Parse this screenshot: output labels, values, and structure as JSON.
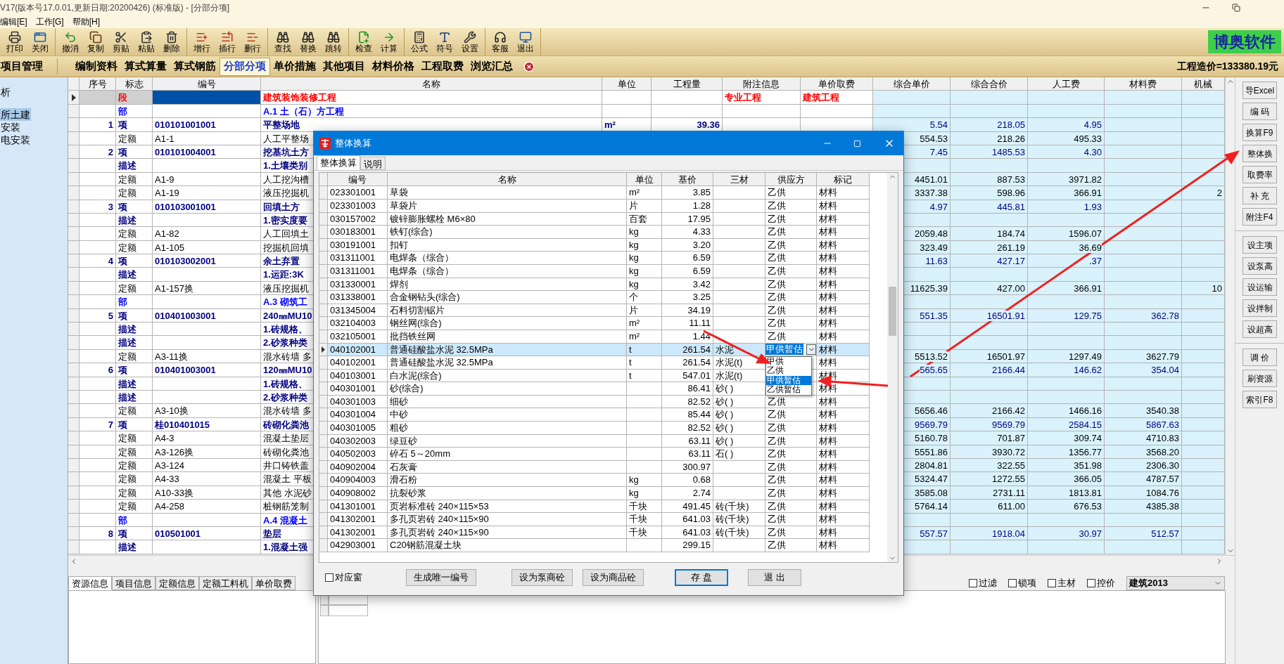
{
  "window": {
    "title": "V17(版本号17.0.01,更新日期:20200426) (标准版) - [分部分项]"
  },
  "menu": [
    "编辑[E]",
    "工作[G]",
    "帮助[H]"
  ],
  "toolbar": [
    [
      "打印",
      "关闭"
    ],
    [
      "撤消",
      "复制",
      "剪贴",
      "粘贴",
      "删除"
    ],
    [
      "增行",
      "插行",
      "删行"
    ],
    [
      "查找",
      "替换",
      "跳转"
    ],
    [
      "检查",
      "计算"
    ],
    [
      "公式",
      "符号",
      "设置"
    ],
    [
      "客服",
      "退出"
    ]
  ],
  "logo": "博奥软件",
  "project_tab": "项目管理",
  "tabs": [
    {
      "label": "编制资料",
      "selected": false
    },
    {
      "label": "算式算量",
      "selected": false
    },
    {
      "label": "算式钢筋",
      "selected": false
    },
    {
      "label": "分部分项",
      "selected": true
    },
    {
      "label": "单价措施",
      "selected": false
    },
    {
      "label": "其他项目",
      "selected": false
    },
    {
      "label": "材料价格",
      "selected": false
    },
    {
      "label": "工程取费",
      "selected": false
    },
    {
      "label": "浏览汇总",
      "selected": false
    }
  ],
  "total": "工程造价=133380.19元",
  "tree": [
    {
      "label": "析",
      "selected": false
    },
    {
      "label": "所土建",
      "selected": true
    },
    {
      "label": "安装",
      "selected": false
    },
    {
      "label": "电安装",
      "selected": false
    }
  ],
  "table": {
    "columns": [
      "序号",
      "标志",
      "编号",
      "名称",
      "单位",
      "工程量",
      "附注信息",
      "单价取费",
      "综合单价",
      "综合合价",
      "人工费",
      "材料费",
      "机械"
    ],
    "rows": [
      {
        "kind": "section",
        "flag": "段",
        "name": "建筑装饰装修工程",
        "note": "专业工程",
        "fee": "建筑工程",
        "selected": true
      },
      {
        "kind": "part",
        "flag": "部",
        "name": "A.1 土（石）方工程",
        "selected": false
      },
      {
        "kind": "item",
        "seq": "1",
        "flag": "项",
        "code": "010101001001",
        "name": "平整场地",
        "unit": "m²",
        "quantity": "39.36",
        "unit_price": "5.54",
        "total": "218.05",
        "labor": "4.95",
        "selected": false
      },
      {
        "kind": "quota",
        "flag": "定额",
        "code": "A1-1",
        "name": "人工平整场",
        "unit_price": "554.53",
        "total": "218.26",
        "labor": "495.33",
        "selected": false
      },
      {
        "kind": "item",
        "seq": "2",
        "flag": "项",
        "code": "010101004001",
        "name": "挖基坑土方",
        "unit_price": "7.45",
        "total": "1485.53",
        "labor": "4.30",
        "selected": false
      },
      {
        "kind": "desc",
        "flag": "描述",
        "name": "1.土壤类别",
        "selected": false
      },
      {
        "kind": "quota",
        "flag": "定额",
        "code": "A1-9",
        "name": "人工挖沟槽",
        "unit_price": "4451.01",
        "total": "887.53",
        "labor": "3971.82",
        "selected": false
      },
      {
        "kind": "quota",
        "flag": "定额",
        "code": "A1-19",
        "name": "液压挖掘机",
        "unit_price": "3337.38",
        "total": "598.96",
        "labor": "366.91",
        "machine": "2",
        "selected": false
      },
      {
        "kind": "item",
        "seq": "3",
        "flag": "项",
        "code": "010103001001",
        "name": "回填土方",
        "unit_price": "4.97",
        "total": "445.81",
        "labor": "1.93",
        "selected": false
      },
      {
        "kind": "desc",
        "flag": "描述",
        "name": "1.密实度要",
        "selected": false
      },
      {
        "kind": "quota",
        "flag": "定额",
        "code": "A1-82",
        "name": "人工回填土",
        "unit_price": "2059.48",
        "total": "184.74",
        "labor": "1596.07",
        "selected": false
      },
      {
        "kind": "quota",
        "flag": "定额",
        "code": "A1-105",
        "name": "挖掘机回填",
        "unit_price": "323.49",
        "total": "261.19",
        "labor": "36.69",
        "selected": false
      },
      {
        "kind": "item",
        "seq": "4",
        "flag": "项",
        "code": "010103002001",
        "name": "余土弃置",
        "unit_price": "11.63",
        "total": "427.17",
        "labor": ".37",
        "selected": false
      },
      {
        "kind": "desc",
        "flag": "描述",
        "name": "1.运距:3K",
        "selected": false
      },
      {
        "kind": "quota",
        "flag": "定额",
        "code": "A1-157换",
        "name": "液压挖掘机",
        "unit_price": "11625.39",
        "total": "427.00",
        "labor": "366.91",
        "machine": "10",
        "selected": false
      },
      {
        "kind": "part",
        "flag": "部",
        "name": "A.3 砌筑工",
        "selected": false
      },
      {
        "kind": "item",
        "seq": "5",
        "flag": "项",
        "code": "010401003001",
        "name": "240㎜MU10",
        "unit_price": "551.35",
        "total": "16501.91",
        "labor": "129.75",
        "material": "362.78",
        "selected": false
      },
      {
        "kind": "desc",
        "flag": "描述",
        "name": "1.砖规格、",
        "selected": false
      },
      {
        "kind": "desc",
        "flag": "描述",
        "name": "2.砂浆种类",
        "selected": false
      },
      {
        "kind": "quota",
        "flag": "定额",
        "code": "A3-11换",
        "name": "混水砖墙 多",
        "unit_price": "5513.52",
        "total": "16501.97",
        "labor": "1297.49",
        "material": "3627.79",
        "selected": false
      },
      {
        "kind": "item",
        "seq": "6",
        "flag": "项",
        "code": "010401003001",
        "name": "120㎜MU10",
        "unit_price": "565.65",
        "total": "2166.44",
        "labor": "146.62",
        "material": "354.04",
        "selected": false
      },
      {
        "kind": "desc",
        "flag": "描述",
        "name": "1.砖规格、",
        "selected": false
      },
      {
        "kind": "desc",
        "flag": "描述",
        "name": "2.砂浆种类",
        "selected": false
      },
      {
        "kind": "quota",
        "flag": "定额",
        "code": "A3-10换",
        "name": "混水砖墙 多",
        "unit_price": "5656.46",
        "total": "2166.42",
        "labor": "1466.16",
        "material": "3540.38",
        "selected": false
      },
      {
        "kind": "item",
        "seq": "7",
        "flag": "项",
        "code": "桂010401015",
        "name": "砖砌化粪池",
        "unit_price": "9569.79",
        "total": "9569.79",
        "labor": "2584.15",
        "material": "5867.63",
        "selected": false
      },
      {
        "kind": "quota",
        "flag": "定额",
        "code": "A4-3",
        "name": "混凝土垫层",
        "unit_price": "5160.78",
        "total": "701.87",
        "labor": "309.74",
        "material": "4710.83",
        "selected": false
      },
      {
        "kind": "quota",
        "flag": "定额",
        "code": "A3-126换",
        "name": "砖砌化粪池",
        "unit_price": "5551.86",
        "total": "3930.72",
        "labor": "1356.77",
        "material": "3568.20",
        "selected": false
      },
      {
        "kind": "quota",
        "flag": "定额",
        "code": "A3-124",
        "name": "井口铸铁盖",
        "unit_price": "2804.81",
        "total": "322.55",
        "labor": "351.98",
        "material": "2306.30",
        "selected": false
      },
      {
        "kind": "quota",
        "flag": "定额",
        "code": "A4-33",
        "name": "混凝土 平板",
        "unit_price": "5324.47",
        "total": "1272.55",
        "labor": "366.05",
        "material": "4787.57",
        "selected": false
      },
      {
        "kind": "quota",
        "flag": "定额",
        "code": "A10-33换",
        "name": "其他 水泥砂",
        "unit_price": "3585.08",
        "total": "2731.11",
        "labor": "1813.81",
        "material": "1084.76",
        "selected": false
      },
      {
        "kind": "quota",
        "flag": "定额",
        "code": "A4-258",
        "name": "桩钢筋笼制",
        "unit_price": "5764.14",
        "total": "611.00",
        "labor": "676.53",
        "material": "4385.38",
        "selected": false
      },
      {
        "kind": "part",
        "flag": "部",
        "name": "A.4 混凝土",
        "selected": false
      },
      {
        "kind": "item",
        "seq": "8",
        "flag": "项",
        "code": "010501001",
        "name": "垫层",
        "unit_price": "557.57",
        "total": "1918.04",
        "labor": "30.97",
        "material": "512.57",
        "selected": false
      },
      {
        "kind": "desc",
        "flag": "描述",
        "name": "1.混凝土强",
        "selected": false
      }
    ]
  },
  "side_buttons": [
    [
      "导Excel",
      "编 码",
      "换算F9",
      "整体换",
      "取费率",
      "补 充",
      "附注F4"
    ],
    [
      "设主项",
      "设泵高",
      "设运输",
      "设拌制",
      "设超高"
    ],
    [
      "调 价",
      "刷资源",
      "索引F8"
    ]
  ],
  "bottom_tabs": [
    {
      "label": "资源信息",
      "selected": true
    },
    {
      "label": "项目信息",
      "selected": false
    },
    {
      "label": "定额信息",
      "selected": false
    },
    {
      "label": "定额工料机",
      "selected": false
    },
    {
      "label": "单价取费",
      "selected": false
    }
  ],
  "filters": [
    {
      "label": "过滤",
      "checked": false
    },
    {
      "label": "锁项",
      "checked": false
    },
    {
      "label": "主材",
      "checked": false
    },
    {
      "label": "控价",
      "checked": false
    }
  ],
  "standard_select": "建筑2013",
  "dialog": {
    "title": "整体换算",
    "tabs": [
      {
        "label": "整体换算",
        "selected": true
      },
      {
        "label": "说明",
        "selected": false
      }
    ],
    "columns": [
      "编号",
      "名称",
      "单位",
      "基价",
      "三材",
      "供应方",
      "标记"
    ],
    "rows": [
      {
        "code": "023301001",
        "name": "草袋",
        "unit": "m²",
        "price": "3.85",
        "supplier": "乙供",
        "mark": "材料",
        "selected": false
      },
      {
        "code": "023301003",
        "name": "草袋片",
        "unit": "片",
        "price": "1.28",
        "supplier": "乙供",
        "mark": "材料",
        "selected": false
      },
      {
        "code": "030157002",
        "name": "镀锌膨胀螺栓 M6×80",
        "unit": "百套",
        "price": "17.95",
        "supplier": "乙供",
        "mark": "材料",
        "selected": false
      },
      {
        "code": "030183001",
        "name": "铁钉(综合)",
        "unit": "kg",
        "price": "4.33",
        "supplier": "乙供",
        "mark": "材料",
        "selected": false
      },
      {
        "code": "030191001",
        "name": "扣钉",
        "unit": "kg",
        "price": "3.20",
        "supplier": "乙供",
        "mark": "材料",
        "selected": false
      },
      {
        "code": "031311001",
        "name": "电焊条（综合）",
        "unit": "kg",
        "price": "6.59",
        "supplier": "乙供",
        "mark": "材料",
        "selected": false
      },
      {
        "code": "031311001",
        "name": "电焊条（综合）",
        "unit": "kg",
        "price": "6.59",
        "supplier": "乙供",
        "mark": "材料",
        "selected": false
      },
      {
        "code": "031330001",
        "name": "焊剂",
        "unit": "kg",
        "price": "3.42",
        "supplier": "乙供",
        "mark": "材料",
        "selected": false
      },
      {
        "code": "031338001",
        "name": "合金钢钻头(综合)",
        "unit": "个",
        "price": "3.25",
        "supplier": "乙供",
        "mark": "材料",
        "selected": false
      },
      {
        "code": "031345004",
        "name": "石料切割锯片",
        "unit": "片",
        "price": "34.19",
        "supplier": "乙供",
        "mark": "材料",
        "selected": false
      },
      {
        "code": "032104003",
        "name": "钢丝网(综合)",
        "unit": "m²",
        "price": "11.11",
        "supplier": "乙供",
        "mark": "材料",
        "selected": false
      },
      {
        "code": "032105001",
        "name": "批挡铁丝网",
        "unit": "m²",
        "price": "1.44",
        "supplier": "乙供",
        "mark": "材料",
        "selected": false
      },
      {
        "code": "040102001",
        "name": "普通硅酸盐水泥 32.5MPa",
        "unit": "t",
        "price": "261.54",
        "material": "水泥",
        "supplier": "甲供暂估",
        "mark": "材料",
        "selected": true,
        "options": [
          {
            "label": "甲供",
            "selected": false
          },
          {
            "label": "乙供",
            "selected": false
          },
          {
            "label": "甲供暂估",
            "selected": true
          },
          {
            "label": "乙供暂估",
            "selected": false
          }
        ]
      },
      {
        "code": "040102001",
        "name": "普通硅酸盐水泥 32.5MPa",
        "unit": "t",
        "price": "261.54",
        "material": "水泥(t)",
        "mark": "材料",
        "selected": false
      },
      {
        "code": "040103001",
        "name": "白水泥(综合)",
        "unit": "t",
        "price": "547.01",
        "material": "水泥(t)",
        "mark": "材料",
        "selected": false
      },
      {
        "code": "040301001",
        "name": "砂(综合)",
        "price": "86.41",
        "material": "砂( )",
        "mark": "材料",
        "selected": false
      },
      {
        "code": "040301003",
        "name": "细砂",
        "price": "82.52",
        "material": "砂( )",
        "supplier": "乙供",
        "mark": "材料",
        "selected": false
      },
      {
        "code": "040301004",
        "name": "中砂",
        "price": "85.44",
        "material": "砂( )",
        "supplier": "乙供",
        "mark": "材料",
        "selected": false
      },
      {
        "code": "040301005",
        "name": "粗砂",
        "price": "82.52",
        "material": "砂( )",
        "supplier": "乙供",
        "mark": "材料",
        "selected": false
      },
      {
        "code": "040302003",
        "name": "绿豆砂",
        "price": "63.11",
        "material": "砂( )",
        "supplier": "乙供",
        "mark": "材料",
        "selected": false
      },
      {
        "code": "040502003",
        "name": "碎石 5～20mm",
        "price": "63.11",
        "material": "石( )",
        "supplier": "乙供",
        "mark": "材料",
        "selected": false
      },
      {
        "code": "040902004",
        "name": "石灰膏",
        "price": "300.97",
        "supplier": "乙供",
        "mark": "材料",
        "selected": false
      },
      {
        "code": "040904003",
        "name": "滑石粉",
        "unit": "kg",
        "price": "0.68",
        "supplier": "乙供",
        "mark": "材料",
        "selected": false
      },
      {
        "code": "040908002",
        "name": "抗裂砂浆",
        "unit": "kg",
        "price": "2.74",
        "supplier": "乙供",
        "mark": "材料",
        "selected": false
      },
      {
        "code": "041301001",
        "name": "页岩标准砖 240×115×53",
        "unit": "千块",
        "price": "491.45",
        "material": "砖(千块)",
        "supplier": "乙供",
        "mark": "材料",
        "selected": false
      },
      {
        "code": "041302001",
        "name": "多孔页岩砖 240×115×90",
        "unit": "千块",
        "price": "641.03",
        "material": "砖(千块)",
        "supplier": "乙供",
        "mark": "材料",
        "selected": false
      },
      {
        "code": "041302001",
        "name": "多孔页岩砖 240×115×90",
        "unit": "千块",
        "price": "641.03",
        "material": "砖(千块)",
        "supplier": "乙供",
        "mark": "材料",
        "selected": false
      },
      {
        "code": "042903001",
        "name": "C20钢筋混凝土块",
        "price": "299.15",
        "supplier": "乙供",
        "mark": "材料",
        "selected": false
      }
    ],
    "sync_checkbox": {
      "label": "对应窗",
      "checked": false
    },
    "buttons": [
      {
        "label": "生成唯一编号",
        "default": false
      },
      {
        "label": "设为泵商砼",
        "default": false
      },
      {
        "label": "设为商品砼",
        "default": false
      },
      {
        "label": "存 盘",
        "default": true
      },
      {
        "label": "退 出",
        "default": false
      }
    ]
  }
}
